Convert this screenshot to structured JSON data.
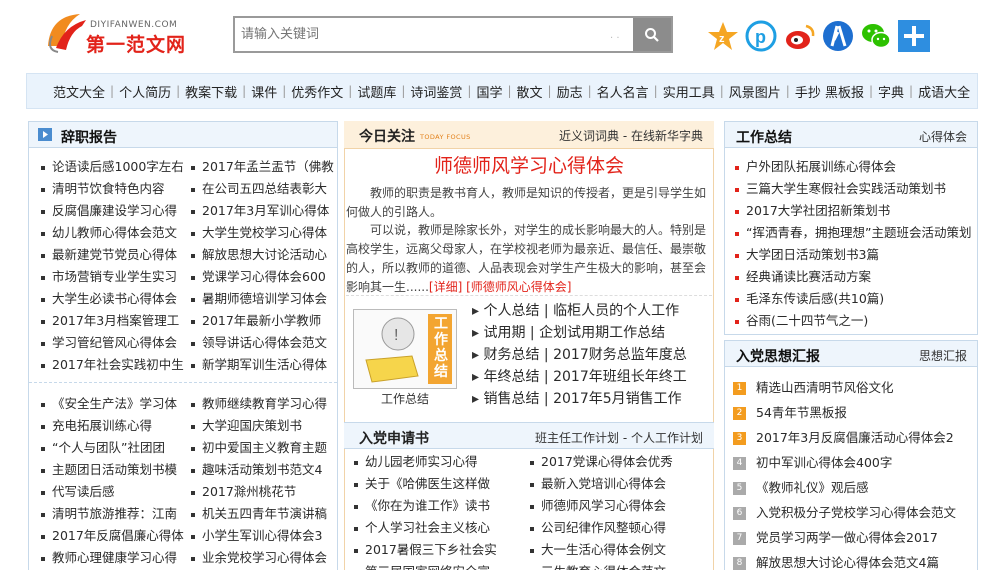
{
  "header": {
    "logo_site": "DIYIFANWEN.COM",
    "logo_cn": "第一范文网",
    "search_placeholder": "请输入关键词",
    "social_icons": [
      "star-icon",
      "pinterest-icon",
      "weibo-icon",
      "renren-icon",
      "wechat-icon",
      "plus-icon"
    ]
  },
  "nav": [
    "范文大全",
    "个人简历",
    "教案下载",
    "课件",
    "优秀作文",
    "试题库",
    "诗词鉴赏",
    "国学",
    "散文",
    "励志",
    "名人名言",
    "实用工具",
    "风景图片",
    "手抄 黑板报",
    "字典",
    "成语大全"
  ],
  "left": {
    "title": "辞职报告",
    "group1_col1": [
      "论语读后感1000字左右",
      "清明节饮食特色内容",
      "反腐倡廉建设学习心得",
      "幼儿教师心得体会范文",
      "最新建党节党员心得体",
      "市场营销专业学生实习",
      "大学生必读书心得体会",
      "2017年3月档案管理工",
      "学习管纪管风心得体会",
      "2017年社会实践初中生"
    ],
    "group1_col2": [
      "2017年孟兰盂节（佛教",
      "在公司五四总结表彰大",
      "2017年3月军训心得体",
      "大学生党校学习心得体",
      "解放思想大讨论活动心",
      "党课学习心得体会600",
      "暑期师德培训学习体会",
      "2017年最新小学教师",
      "领导讲话心得体会范文",
      "新学期军训生活心得体"
    ],
    "group2_col1": [
      "《安全生产法》学习体",
      "充电拓展训练心得",
      "“个人与团队”社团团",
      "主题团日活动策划书模",
      "代写读后感",
      "清明节旅游推荐：江南",
      "2017年反腐倡廉心得体",
      "教师心理健康学习心得"
    ],
    "group2_col2": [
      "教师继续教育学习心得",
      "大学迎国庆策划书",
      "初中爱国主义教育主题",
      "趣味活动策划书范文4",
      "2017滁州桃花节",
      "机关五四青年节演讲稿",
      "小学生军训心得体会3",
      "业余党校学习心得体会"
    ]
  },
  "center": {
    "head_title": "今日关注",
    "head_sub": "TODAY FOCUS",
    "head_right": "近义词词典 - 在线新华字典",
    "article_title": "师德师风学习心得体会",
    "para1": "教师的职责是教书育人，教师是知识的传授者，更是引导学生如何做人的引路人。",
    "para2": "可以说，教师是除家长外，对学生的成长影响最大的人。特别是高校学生，远离父母家人，在学校视老师为最亲近、最信任、最崇敬的人，所以教师的道德、人品表现会对学生产生极大的影响，甚至会影响其一生......",
    "detail_link": "[详细]",
    "related_link": "[师德师风心得体会]",
    "image_text": "工作总结",
    "image_caption": "工作总结",
    "featured": [
      [
        "个人总结",
        "临柜人员的个人工作"
      ],
      [
        "试用期",
        "企划试用期工作总结"
      ],
      [
        "财务总结",
        "2017财务总监年度总"
      ],
      [
        "年终总结",
        "2017年班组长年终工"
      ],
      [
        "销售总结",
        "2017年5月销售工作"
      ]
    ],
    "section2_title": "入党申请书",
    "section2_right": "班主任工作计划 - 个人工作计划",
    "section2_col1": [
      "幼儿园老师实习心得",
      "关于《哈佛医生这样做",
      "《你在为谁工作》读书",
      "个人学习社会主义核心",
      "2017暑假三下乡社会实",
      "第三届国家网络安全宣"
    ],
    "section2_col2": [
      "2017党课心得体会优秀",
      "最新入党培训心得体会",
      "师德师风学习心得体会",
      "公司纪律作风整顿心得",
      "大一生活心得体会例文",
      "三生教育心得体会范文"
    ]
  },
  "right": {
    "box1_title": "工作总结",
    "box1_more": "心得体会",
    "box1_items": [
      "户外团队拓展训练心得体会",
      "三篇大学生寒假社会实践活动策划书",
      "2017大学社团招新策划书",
      "“挥洒青春，拥抱理想”主题班会活动策划",
      "大学团日活动策划书3篇",
      "经典诵读比赛活动方案",
      "毛泽东传读后感(共10篇)",
      "谷雨(二十四节气之一)"
    ],
    "box2_title": "入党思想汇报",
    "box2_more": "思想汇报",
    "box2_items": [
      "精选山西清明节风俗文化",
      "54青年节黑板报",
      "2017年3月反腐倡廉活动心得体会2",
      "初中军训心得体会400字",
      "《教师礼仪》观后感",
      "入党积极分子党校学习心得体会范文",
      "党员学习两学一做心得体会2017",
      "解放思想大讨论心得体会范文4篇"
    ]
  },
  "colors": {
    "brand_red": "#e2231a",
    "nav_bg": "#eaf3fc",
    "border_blue": "#c7d9ea",
    "focus_bg": "#fdf0dc",
    "badge_orange": "#f39c1f"
  }
}
